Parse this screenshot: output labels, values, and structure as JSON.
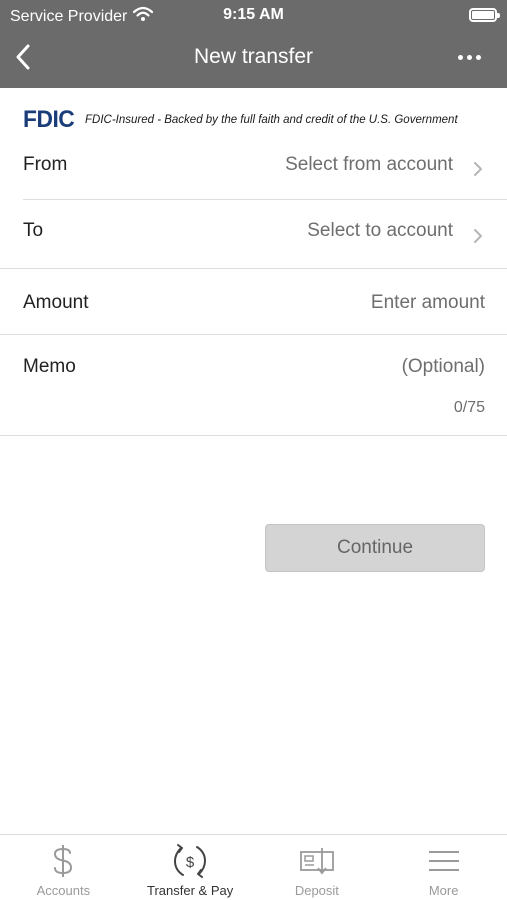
{
  "status_bar": {
    "carrier": "Service Provider",
    "time": "9:15 AM"
  },
  "nav": {
    "title": "New transfer",
    "back_icon": "chevron-left-icon",
    "more_icon": "ellipsis-icon"
  },
  "fdic": {
    "logo": "FDIC",
    "text": "FDIC-Insured - Backed by the full faith and credit of the U.S. Government"
  },
  "form": {
    "from": {
      "label": "From",
      "value": "Select from account"
    },
    "to": {
      "label": "To",
      "value": "Select to account"
    },
    "amount": {
      "label": "Amount",
      "placeholder": "Enter amount"
    },
    "memo": {
      "label": "Memo",
      "placeholder": "(Optional)",
      "counter": "0/75"
    }
  },
  "continue_label": "Continue",
  "tabs": [
    {
      "label": "Accounts",
      "icon": "dollar-icon",
      "active": false
    },
    {
      "label": "Transfer & Pay",
      "icon": "transfer-dollar-icon",
      "active": true
    },
    {
      "label": "Deposit",
      "icon": "check-deposit-icon",
      "active": false
    },
    {
      "label": "More",
      "icon": "menu-icon",
      "active": false
    }
  ],
  "colors": {
    "header_bg": "#6b6b6b",
    "fdic_blue": "#1b3d7a",
    "disabled_button": "#d4d4d4"
  }
}
